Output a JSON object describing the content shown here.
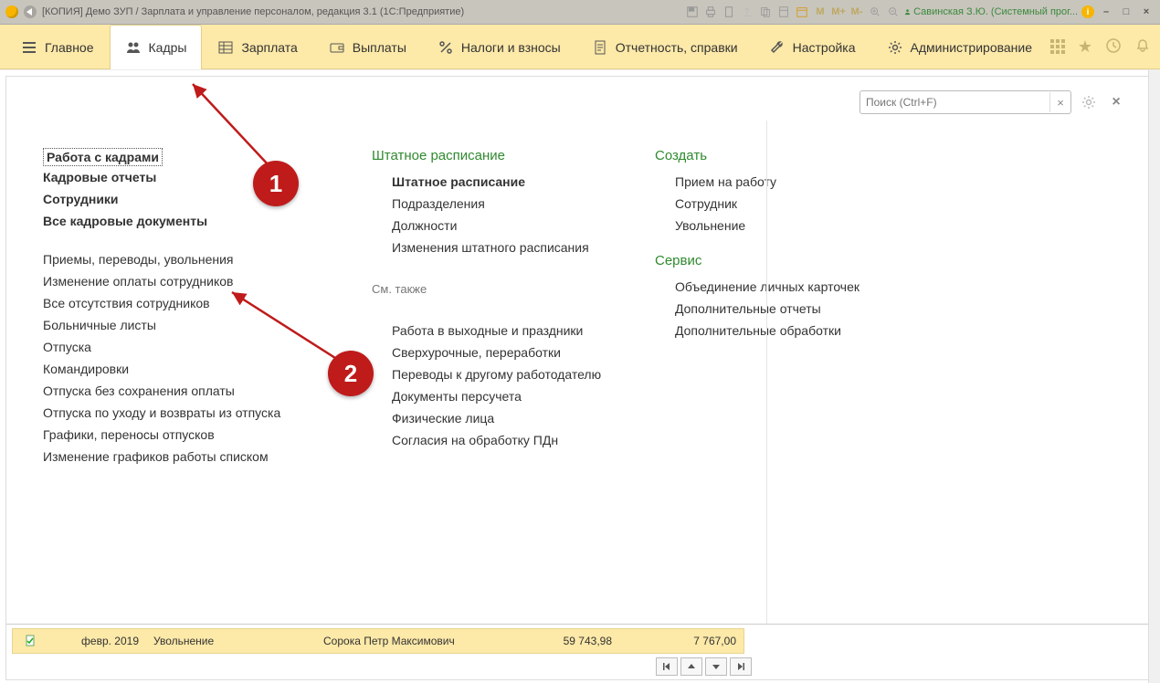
{
  "titlebar": {
    "title": "[КОПИЯ] Демо ЗУП / Зарплата и управление персоналом, редакция 3.1  (1С:Предприятие)",
    "calc_M": "M",
    "calc_Mplus": "M+",
    "calc_Mminus": "M-",
    "user_label": "Савинская З.Ю. (Системный прог...",
    "min": "–",
    "max": "□",
    "close": "×"
  },
  "nav": {
    "items": [
      {
        "label": "Главное"
      },
      {
        "label": "Кадры"
      },
      {
        "label": "Зарплата"
      },
      {
        "label": "Выплаты"
      },
      {
        "label": "Налоги и взносы"
      },
      {
        "label": "Отчетность, справки"
      },
      {
        "label": "Настройка"
      },
      {
        "label": "Администрирование"
      }
    ]
  },
  "search": {
    "placeholder": "Поиск (Ctrl+F)"
  },
  "col1": {
    "selected": "Работа с кадрами",
    "i1": "Кадровые отчеты",
    "i2": "Сотрудники",
    "i3": "Все кадровые документы",
    "i4": "Приемы, переводы, увольнения",
    "i5": "Изменение оплаты сотрудников",
    "i6": "Все отсутствия сотрудников",
    "i7": "Больничные листы",
    "i8": "Отпуска",
    "i9": "Командировки",
    "i10": "Отпуска без сохранения оплаты",
    "i11": "Отпуска по уходу и возвраты из отпуска",
    "i12": "Графики, переносы отпусков",
    "i13": "Изменение графиков работы списком"
  },
  "col2": {
    "title": "Штатное расписание",
    "i1": "Штатное расписание",
    "i2": "Подразделения",
    "i3": "Должности",
    "i4": "Изменения штатного расписания",
    "see_also": "См. также",
    "j1": "Работа в выходные и праздники",
    "j2": "Сверхурочные, переработки",
    "j3": "Переводы к другому работодателю",
    "j4": "Документы персучета",
    "j5": "Физические лица",
    "j6": "Согласия на обработку ПДн"
  },
  "col3": {
    "title1": "Создать",
    "c1": "Прием на работу",
    "c2": "Сотрудник",
    "c3": "Увольнение",
    "title2": "Сервис",
    "s1": "Объединение личных карточек",
    "s2": "Дополнительные отчеты",
    "s3": "Дополнительные обработки"
  },
  "grid": {
    "period": "февр. 2019",
    "type": "Увольнение",
    "name": "Сорока Петр Максимович",
    "sum1": "59 743,98",
    "sum2": "7 767,00"
  },
  "callouts": {
    "n1": "1",
    "n2": "2"
  }
}
